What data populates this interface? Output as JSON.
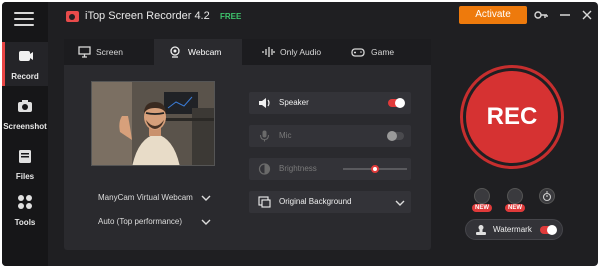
{
  "app": {
    "title": "iTop Screen Recorder 4.2",
    "edition": "FREE",
    "activate_label": "Activate"
  },
  "sidebar": {
    "items": [
      {
        "label": "Record",
        "icon": "record-icon",
        "active": true
      },
      {
        "label": "Screenshot",
        "icon": "camera-icon",
        "active": false
      },
      {
        "label": "Files",
        "icon": "files-icon",
        "active": false
      },
      {
        "label": "Tools",
        "icon": "tools-icon",
        "active": false
      }
    ]
  },
  "tabs": [
    {
      "label": "Screen",
      "icon": "monitor-icon"
    },
    {
      "label": "Webcam",
      "icon": "webcam-icon",
      "active": true
    },
    {
      "label": "Only Audio",
      "icon": "audio-wave-icon"
    },
    {
      "label": "Game",
      "icon": "gamepad-icon"
    }
  ],
  "webcam": {
    "device": "ManyCam Virtual Webcam",
    "performance": "Auto (Top performance)"
  },
  "settings": {
    "speaker_label": "Speaker",
    "speaker_on": true,
    "mic_label": "Mic",
    "mic_on": false,
    "brightness_label": "Brightness",
    "brightness_level": 0.5,
    "background_label": "Original Background"
  },
  "record": {
    "rec_label": "REC",
    "new_badge": "NEW",
    "watermark_label": "Watermark",
    "watermark_on": true
  },
  "colors": {
    "accent_red": "#d63232",
    "activate_orange": "#ee7a0c",
    "free_green": "#3ec46d"
  }
}
